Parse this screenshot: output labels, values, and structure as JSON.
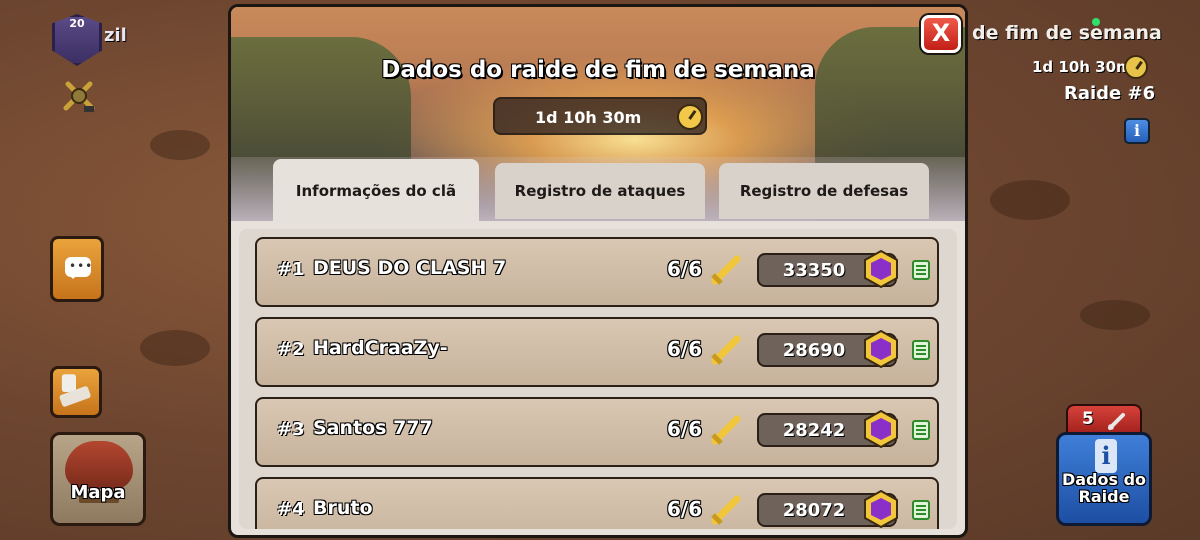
{
  "hud": {
    "clan_level": "20",
    "clan_name": "zil",
    "raid_title": "de fim de semana",
    "raid_timer": "1d 10h 30m",
    "raid_number": "Raide #6",
    "info_label": "i",
    "chat_dots": "•••",
    "map_label": "Mapa",
    "attacks_left": "5",
    "raid_data_label": "Dados do Raide"
  },
  "modal": {
    "title": "Dados do raide de fim de semana",
    "timer": "1d 10h 30m",
    "close_label": "X",
    "tabs": [
      {
        "label": "Informações do clã",
        "active": true
      },
      {
        "label": "Registro de ataques",
        "active": false
      },
      {
        "label": "Registro de defesas",
        "active": false
      }
    ],
    "rows": [
      {
        "rank": "#1",
        "name": "DEUS DO CLASH 7",
        "attacks": "6/6",
        "loot": "33350"
      },
      {
        "rank": "#2",
        "name": "HardCraaZy-",
        "attacks": "6/6",
        "loot": "28690"
      },
      {
        "rank": "#3",
        "name": "Santos 777",
        "attacks": "6/6",
        "loot": "28242"
      },
      {
        "rank": "#4",
        "name": "Bruto",
        "attacks": "6/6",
        "loot": "28072"
      }
    ]
  },
  "colors": {
    "accent_gold": "#f1c84a",
    "gem_purple": "#8a2fc8",
    "close_red": "#c21f17",
    "blue_button": "#2660b8"
  },
  "icons": [
    "clan-badge-icon",
    "league-icon",
    "chat-icon",
    "troops-icon",
    "map-icon",
    "clock-icon",
    "info-icon",
    "sword-icon",
    "capital-gold-gem-icon",
    "detail-list-icon",
    "close-icon"
  ]
}
